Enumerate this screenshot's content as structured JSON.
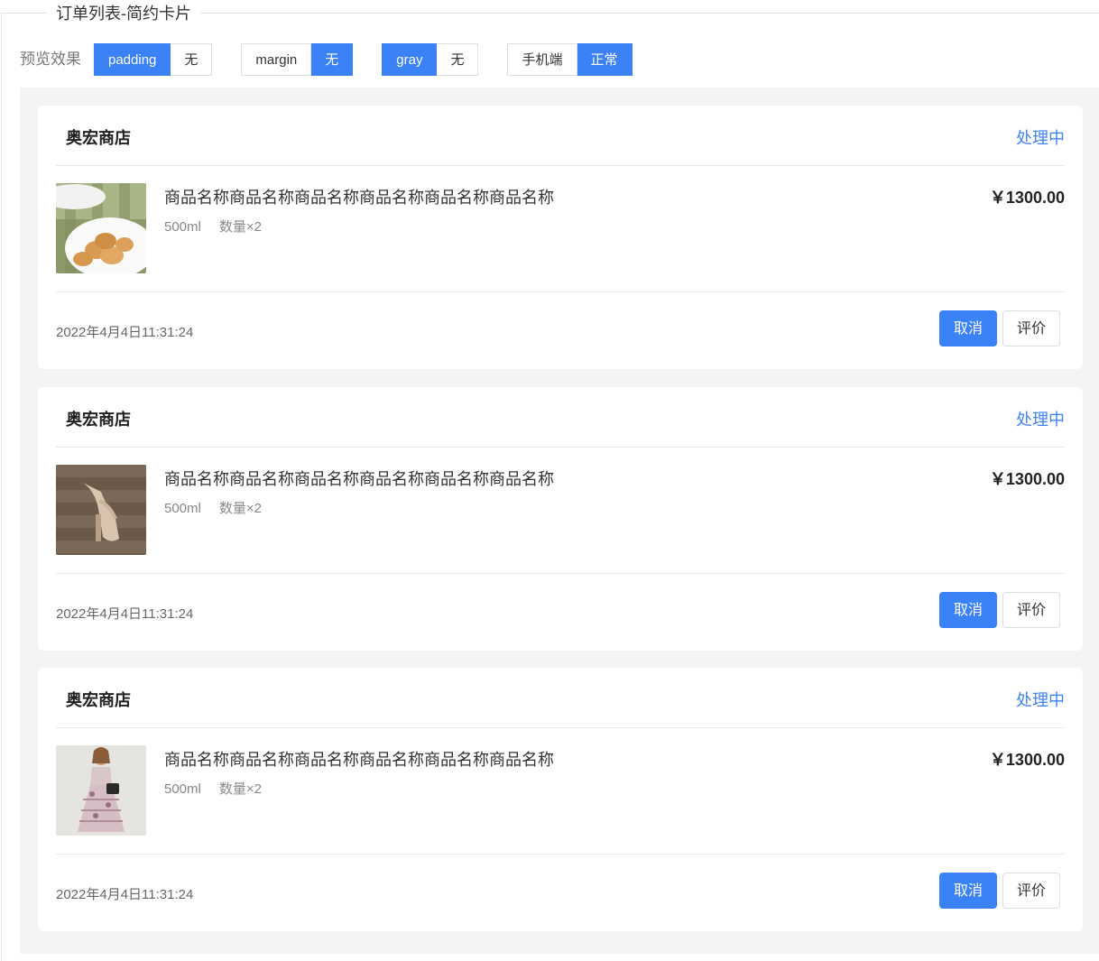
{
  "legend": "订单列表-简约卡片",
  "controls": {
    "label": "预览效果",
    "groups": [
      {
        "options": [
          "padding",
          "无"
        ],
        "active": 0
      },
      {
        "options": [
          "margin",
          "无"
        ],
        "active": 1
      },
      {
        "options": [
          "gray",
          "无"
        ],
        "active": 0
      },
      {
        "options": [
          "手机端",
          "正常"
        ],
        "active": 1
      }
    ]
  },
  "colors": {
    "accent": "#3b82f6",
    "preview_bg": "#f3f4f6",
    "divider": "#e8e8e8"
  },
  "orders": [
    {
      "shop": "奥宏商店",
      "status": "处理中",
      "item_name": "商品名称商品名称商品名称商品名称商品名称商品名称",
      "spec": "500ml",
      "quantity": "数量×2",
      "price": "￥1300.00",
      "time": "2022年4月4日11:31:24",
      "image": "cookies-plate-photo",
      "actions": [
        "取消",
        "评价"
      ]
    },
    {
      "shop": "奥宏商店",
      "status": "处理中",
      "item_name": "商品名称商品名称商品名称商品名称商品名称商品名称",
      "spec": "500ml",
      "quantity": "数量×2",
      "price": "￥1300.00",
      "time": "2022年4月4日11:31:24",
      "image": "sandal-photo",
      "actions": [
        "取消",
        "评价"
      ]
    },
    {
      "shop": "奥宏商店",
      "status": "处理中",
      "item_name": "商品名称商品名称商品名称商品名称商品名称商品名称",
      "spec": "500ml",
      "quantity": "数量×2",
      "price": "￥1300.00",
      "time": "2022年4月4日11:31:24",
      "image": "floral-dress-photo",
      "actions": [
        "取消",
        "评价"
      ]
    }
  ]
}
